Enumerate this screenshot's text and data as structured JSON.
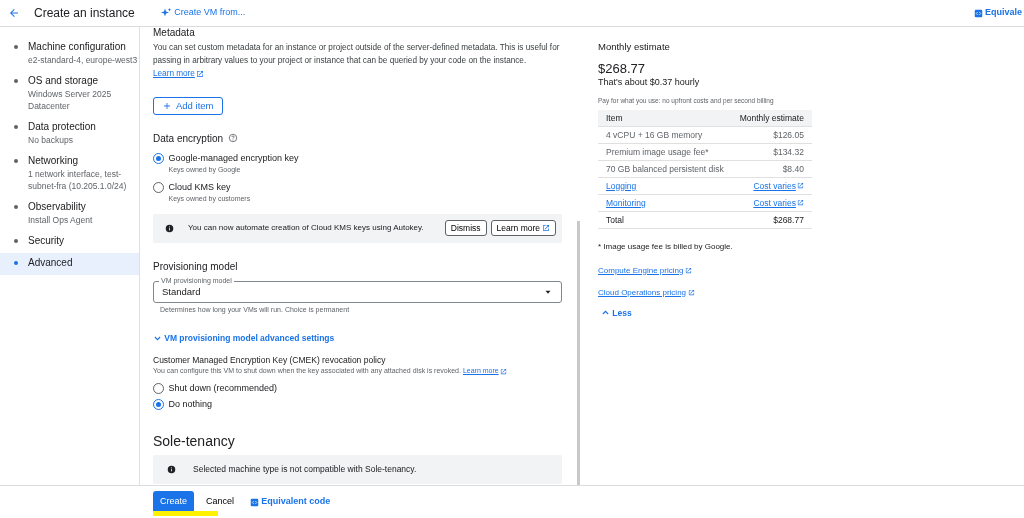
{
  "header": {
    "title": "Create an instance",
    "create_from": "Create VM from...",
    "equivalent_code": "Equivale"
  },
  "sidebar": {
    "items": [
      {
        "title": "Machine configuration",
        "subtitle": "e2-standard-4, europe-west3",
        "selected": false
      },
      {
        "title": "OS and storage",
        "subtitle": "Windows Server 2025 Datacenter",
        "selected": false
      },
      {
        "title": "Data protection",
        "subtitle": "No backups",
        "selected": false
      },
      {
        "title": "Networking",
        "subtitle": "1 network interface, test-subnet-fra (10.205.1.0/24)",
        "selected": false
      },
      {
        "title": "Observability",
        "subtitle": "Install Ops Agent",
        "selected": false
      },
      {
        "title": "Security",
        "selected": false
      },
      {
        "title": "Advanced",
        "selected": true
      }
    ]
  },
  "metadata": {
    "heading": "Metadata",
    "description": "You can set custom metadata for an instance or project outside of the server-defined metadata. This is useful for passing in arbitrary values to your project or instance that can be queried by your code on the instance.",
    "learn_more": "Learn more",
    "add_item": "Add item"
  },
  "data_encryption": {
    "heading": "Data encryption",
    "options": [
      {
        "label": "Google-managed encryption key",
        "sublabel": "Keys owned by Google",
        "selected": true
      },
      {
        "label": "Cloud KMS key",
        "sublabel": "Keys owned by customers",
        "selected": false
      }
    ],
    "banner": {
      "text": "You can now automate creation of Cloud KMS keys using Autokey.",
      "dismiss": "Dismiss",
      "learn_more": "Learn more"
    }
  },
  "provisioning": {
    "heading": "Provisioning model",
    "field_label": "VM provisioning model",
    "value": "Standard",
    "helper": "Determines how long your VMs will run. Choice is permanent",
    "advanced_link": "VM provisioning model advanced settings"
  },
  "cmek": {
    "heading": "Customer Managed Encryption Key (CMEK) revocation policy",
    "description": "You can configure this VM to shut down when the key associated with any attached disk is revoked.",
    "learn_more": "Learn more",
    "options": [
      {
        "label": "Shut down (recommended)",
        "selected": false
      },
      {
        "label": "Do nothing",
        "selected": true
      }
    ]
  },
  "sole_tenancy": {
    "heading": "Sole-tenancy",
    "banner_text": "Selected machine type is not compatible with Sole-tenancy."
  },
  "estimate": {
    "heading": "Monthly estimate",
    "total": "$268.77",
    "hourly": "That's about $0.37 hourly",
    "note": "Pay for what you use: no upfront costs and per second billing",
    "table": {
      "columns": [
        "Item",
        "Monthly estimate"
      ],
      "rows": [
        {
          "kind": "text",
          "item": "4 vCPU + 16 GB memory",
          "cost": "$126.05"
        },
        {
          "kind": "text",
          "item": "Premium image usage fee*",
          "cost": "$134.32"
        },
        {
          "kind": "text",
          "item": "70 GB balanced persistent disk",
          "cost": "$8.40"
        },
        {
          "kind": "link",
          "item": "Logging",
          "cost": "Cost varies"
        },
        {
          "kind": "link",
          "item": "Monitoring",
          "cost": "Cost varies"
        },
        {
          "kind": "total",
          "item": "Total",
          "cost": "$268.77"
        }
      ]
    },
    "footnote": "* Image usage fee is billed by Google.",
    "links": [
      "Compute Engine pricing",
      "Cloud Operations pricing"
    ],
    "less": "Less"
  },
  "footer": {
    "create": "Create",
    "cancel": "Cancel",
    "equivalent_code": "Equivalent code"
  }
}
